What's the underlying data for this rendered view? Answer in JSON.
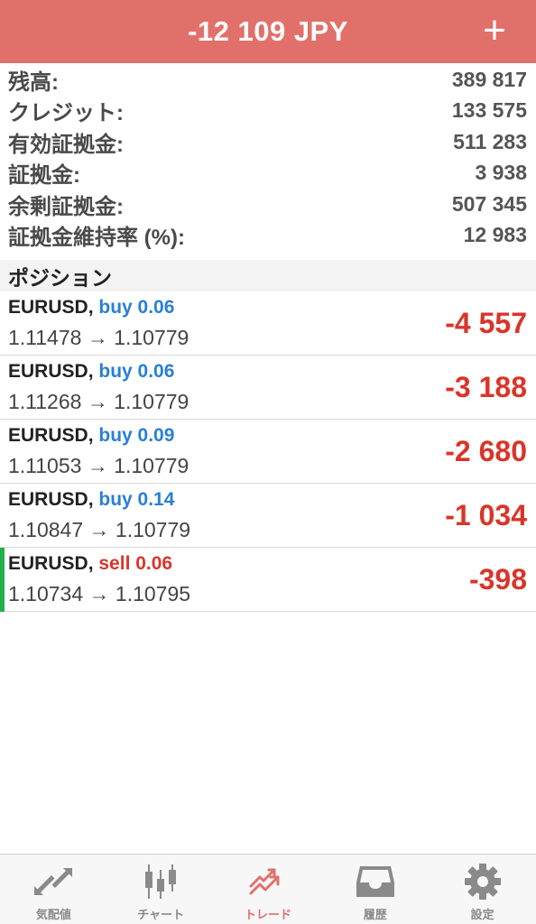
{
  "header": {
    "balance_title": "-12 109 JPY",
    "add_symbol": "+"
  },
  "summary": [
    {
      "label": "残高:",
      "value": "389 817"
    },
    {
      "label": "クレジット:",
      "value": "133 575"
    },
    {
      "label": "有効証拠金:",
      "value": "511 283"
    },
    {
      "label": "証拠金:",
      "value": "3 938"
    },
    {
      "label": "余剰証拠金:",
      "value": "507 345"
    },
    {
      "label": "証拠金維持率 (%):",
      "value": "12 983"
    }
  ],
  "positions_title": "ポジション",
  "positions": [
    {
      "symbol": "EURUSD",
      "comma": ",",
      "side": "buy 0.06",
      "prices": "1.11478 → 1.10779",
      "profit": "-4 557"
    },
    {
      "symbol": "EURUSD",
      "comma": ",",
      "side": "buy 0.06",
      "prices": "1.11268 → 1.10779",
      "profit": "-3 188"
    },
    {
      "symbol": "EURUSD",
      "comma": ",",
      "side": "buy 0.09",
      "prices": "1.11053 → 1.10779",
      "profit": "-2 680"
    },
    {
      "symbol": "EURUSD",
      "comma": ",",
      "side": "buy 0.14",
      "prices": "1.10847 → 1.10779",
      "profit": "-1 034"
    },
    {
      "symbol": "EURUSD",
      "comma": ",",
      "side": "sell 0.06",
      "prices": "1.10734 → 1.10795",
      "profit": "-398"
    }
  ],
  "tabs": [
    {
      "label": "気配値",
      "icon": "quotes-arrows-icon",
      "active": false
    },
    {
      "label": "チャート",
      "icon": "candlestick-chart-icon",
      "active": false
    },
    {
      "label": "トレード",
      "icon": "trade-trend-icon",
      "active": true
    },
    {
      "label": "履歴",
      "icon": "history-inbox-icon",
      "active": false
    },
    {
      "label": "設定",
      "icon": "settings-gear-icon",
      "active": false
    }
  ],
  "colors": {
    "header_bg": "#e2706a",
    "buy": "#2a7fd4",
    "sell": "#d9352b",
    "loss": "#d9352b",
    "active_marker": "#22b04a",
    "active_tab": "#e2706a",
    "inactive_tab": "#8a8a8a"
  }
}
